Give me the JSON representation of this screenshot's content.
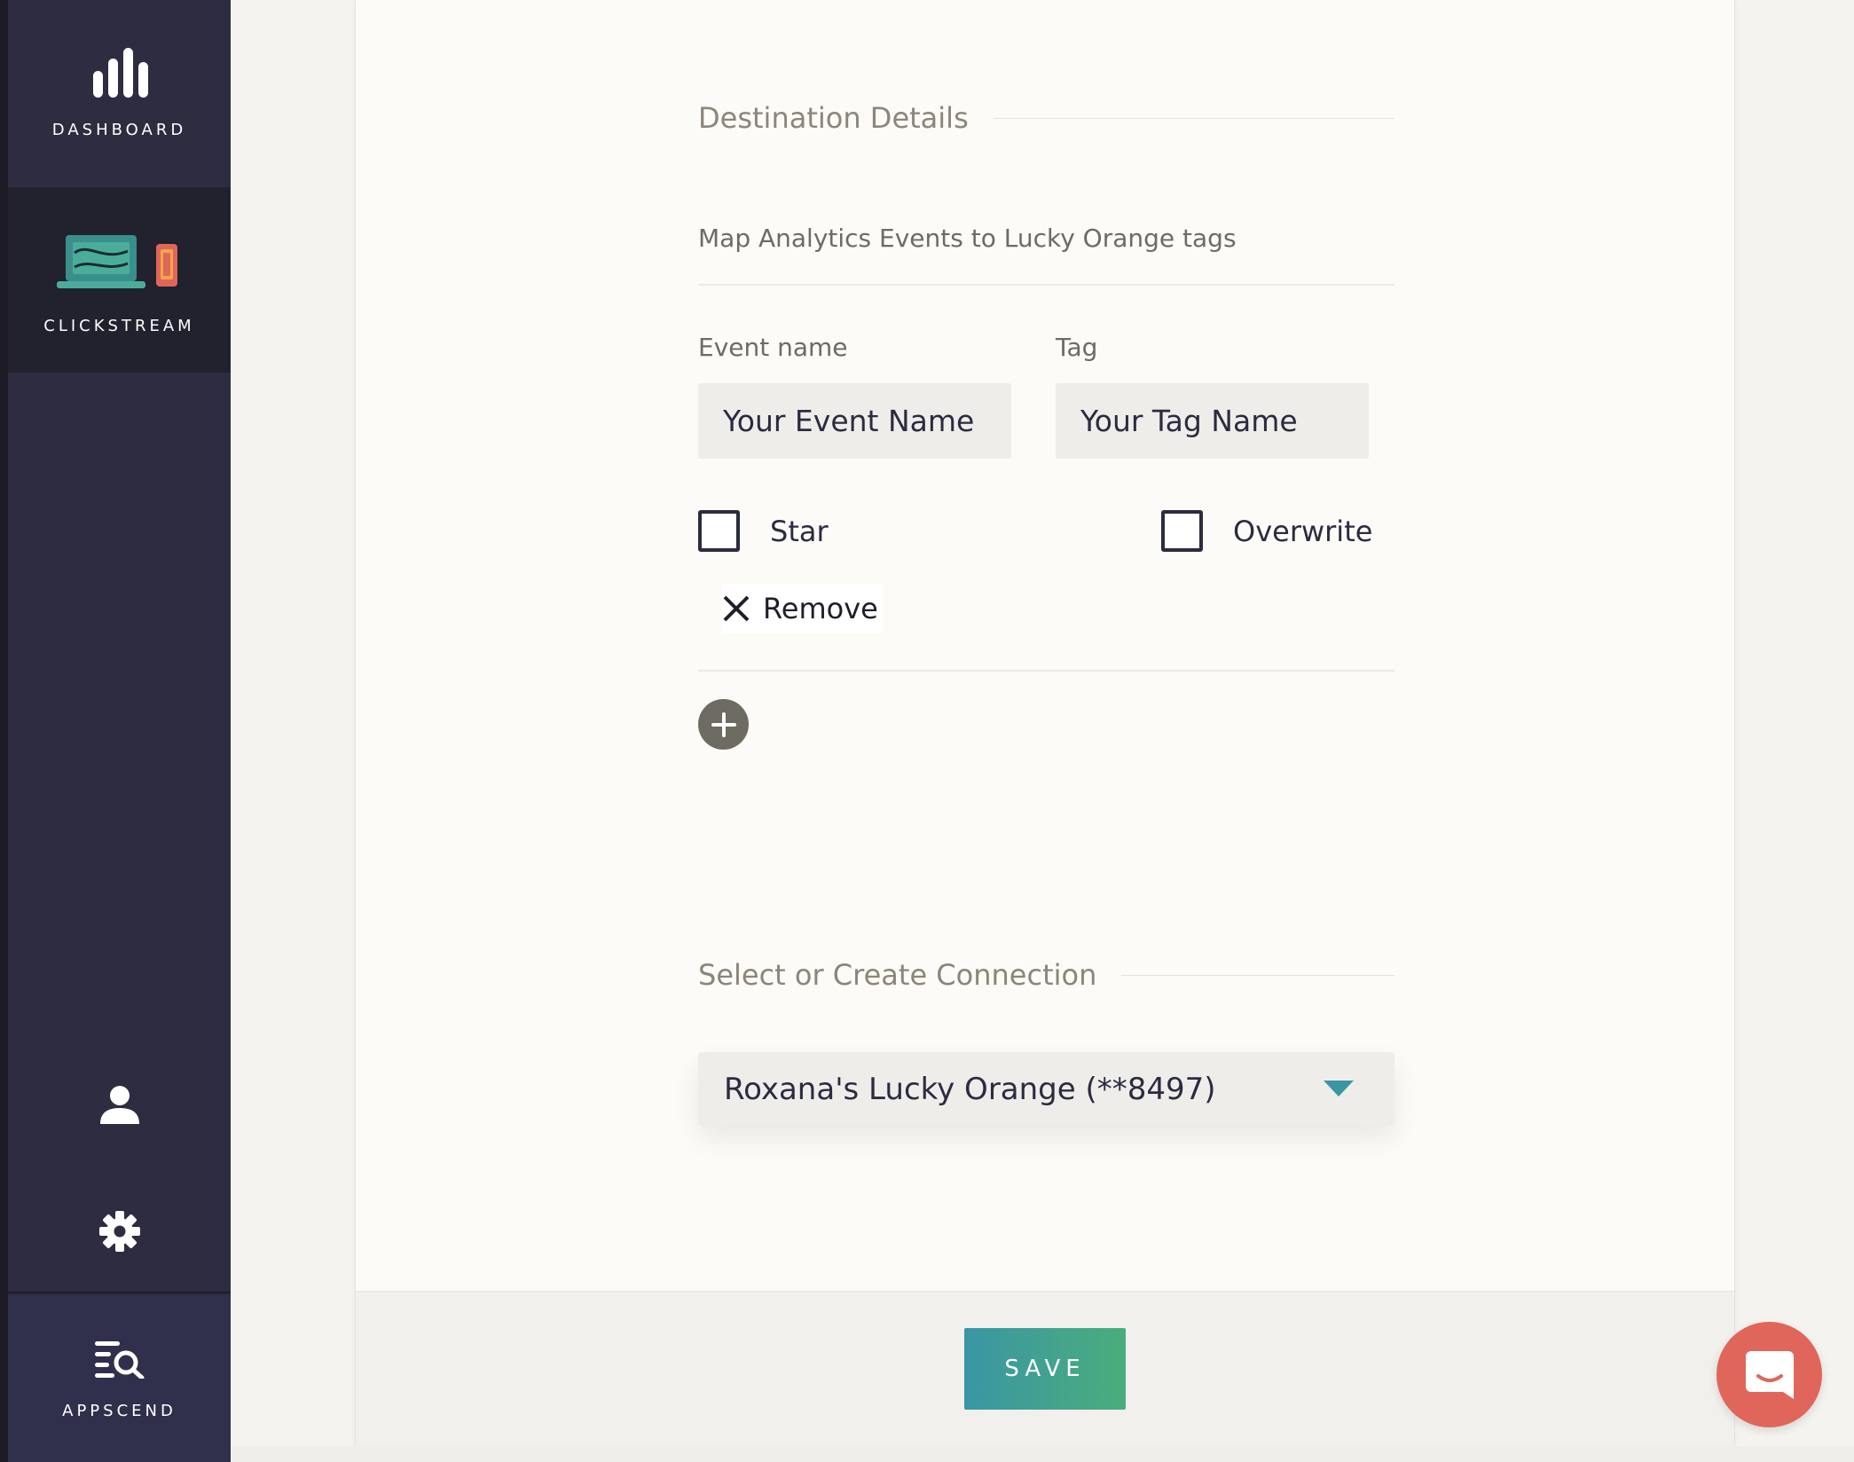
{
  "sidebar": {
    "dashboard_label": "DASHBOARD",
    "clickstream_label": "CLICKSTREAM",
    "appscend_label": "APPSCEND",
    "icons": [
      "bars-chart-icon",
      "laptop-phone-icon",
      "user-icon",
      "gear-icon",
      "search-list-icon"
    ]
  },
  "destination": {
    "section_title": "Destination Details",
    "subtitle": "Map Analytics Events to Lucky Orange tags",
    "event_label": "Event name",
    "event_placeholder": "Your Event Name",
    "tag_label": "Tag",
    "tag_placeholder": "Your Tag Name",
    "star_label": "Star",
    "overwrite_label": "Overwrite",
    "remove_label": "Remove",
    "star_checked": false,
    "overwrite_checked": false
  },
  "connection": {
    "section_title": "Select or Create Connection",
    "selected": "Roxana's Lucky Orange (**8497)"
  },
  "footer": {
    "save_label": "SAVE"
  },
  "colors": {
    "sidebar_bg": "#2e2c40",
    "accent_teal": "#3a96a4",
    "accent_green": "#4aad7c",
    "chat_bubble": "#e0665b",
    "dropdown_arrow": "#3a96a4"
  }
}
